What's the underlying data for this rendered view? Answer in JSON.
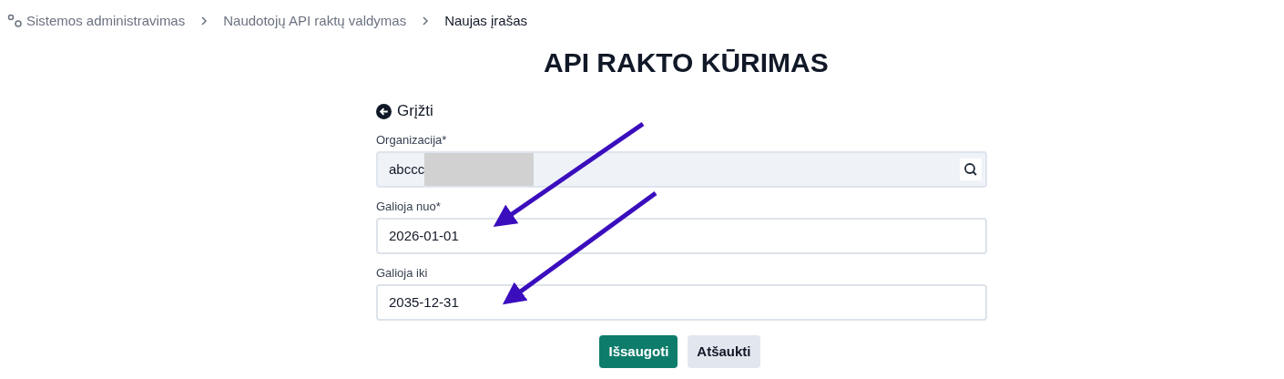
{
  "breadcrumb": [
    {
      "label": "Sistemos administravimas",
      "current": false
    },
    {
      "label": "Naudotojų API raktų valdymas",
      "current": false
    },
    {
      "label": "Naujas įrašas",
      "current": true
    }
  ],
  "title": "API RAKTO KŪRIMAS",
  "back_link": "Grįžti",
  "fields": [
    {
      "label": "Organizacija*",
      "value": "abccc",
      "redacted": true,
      "disabled": true,
      "kind": "lookup"
    },
    {
      "label": "Galioja nuo*",
      "value": "2026-01-01",
      "redacted": false,
      "disabled": false,
      "kind": "text"
    },
    {
      "label": "Galioja iki",
      "value": "2035-12-31",
      "redacted": false,
      "disabled": false,
      "kind": "text"
    }
  ],
  "buttons": [
    {
      "label": "Išsaugoti",
      "kind": "primary"
    },
    {
      "label": "Atšaukti",
      "kind": "secondary"
    }
  ]
}
